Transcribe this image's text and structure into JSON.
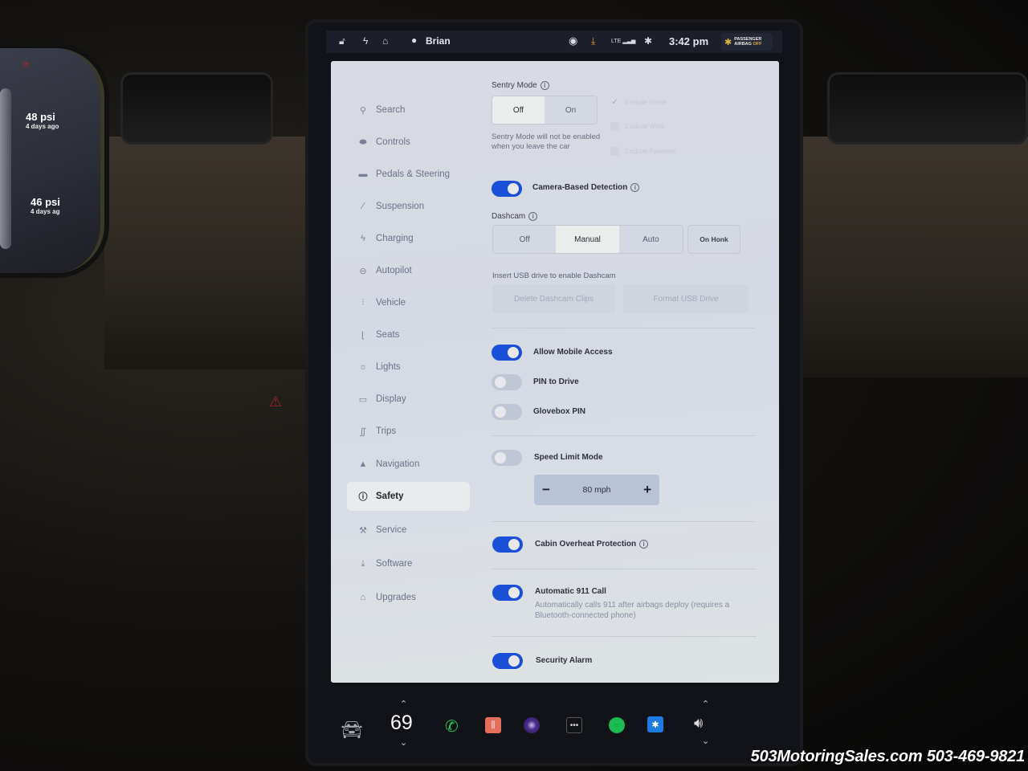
{
  "cluster": {
    "front_tire": {
      "pressure": "48",
      "unit": "psi",
      "age": "4 days ago"
    },
    "rear_tire": {
      "pressure": "46",
      "unit": "psi",
      "age": "4 days ag"
    }
  },
  "statusbar": {
    "icons": [
      "lock-open-icon",
      "bolt-icon",
      "home-link-icon"
    ],
    "user": "Brian",
    "right_icons": [
      "dashcam-record-icon",
      "download-update-icon",
      "lte-signal-icon",
      "bluetooth-icon"
    ],
    "lte_label": "LTE",
    "time": "3:42 pm",
    "airbag": {
      "line1": "PASSENGER",
      "line2_prefix": "AIRBAG",
      "line2_state": "OFF"
    }
  },
  "sidebar": {
    "items": [
      {
        "label": "Search",
        "icon": "search-icon",
        "glyph": "⚲"
      },
      {
        "label": "Controls",
        "icon": "toggle-icon",
        "glyph": "⬬"
      },
      {
        "label": "Pedals & Steering",
        "icon": "car-icon",
        "glyph": "▬"
      },
      {
        "label": "Suspension",
        "icon": "suspension-icon",
        "glyph": "⁄"
      },
      {
        "label": "Charging",
        "icon": "bolt-icon",
        "glyph": "ϟ"
      },
      {
        "label": "Autopilot",
        "icon": "steering-wheel-icon",
        "glyph": "⊖"
      },
      {
        "label": "Vehicle",
        "icon": "sliders-icon",
        "glyph": "⫶"
      },
      {
        "label": "Seats",
        "icon": "seat-icon",
        "glyph": "⌊"
      },
      {
        "label": "Lights",
        "icon": "sun-icon",
        "glyph": "☼"
      },
      {
        "label": "Display",
        "icon": "display-icon",
        "glyph": "▭"
      },
      {
        "label": "Trips",
        "icon": "trips-icon",
        "glyph": "∬"
      },
      {
        "label": "Navigation",
        "icon": "navigation-icon",
        "glyph": "▲"
      },
      {
        "label": "Safety",
        "icon": "safety-icon",
        "glyph": "ⓘ",
        "active": true
      },
      {
        "label": "Service",
        "icon": "wrench-icon",
        "glyph": "⚒"
      },
      {
        "label": "Software",
        "icon": "download-icon",
        "glyph": "⤓"
      },
      {
        "label": "Upgrades",
        "icon": "lock-icon",
        "glyph": "⌂"
      }
    ]
  },
  "safety": {
    "sentry": {
      "title": "Sentry Mode",
      "options": [
        "Off",
        "On"
      ],
      "selected": "Off",
      "note": "Sentry Mode will not be enabled when you leave the car",
      "exclude_home": "Exclude Home",
      "exclude_home_checked": true,
      "exclude_work": "Exclude Work",
      "exclude_work_checked": false,
      "exclude_favorites": "Exclude Favorites",
      "exclude_favorites_checked": false
    },
    "camera_detection": {
      "label": "Camera-Based Detection",
      "on": true
    },
    "dashcam": {
      "title": "Dashcam",
      "options": [
        "Off",
        "Manual",
        "Auto"
      ],
      "selected": "Manual",
      "on_honk": "On Honk",
      "usb_note": "Insert USB drive to enable Dashcam",
      "delete_clips": "Delete Dashcam Clips",
      "format_usb": "Format USB Drive"
    },
    "allow_mobile_access": {
      "label": "Allow Mobile Access",
      "on": true
    },
    "pin_to_drive": {
      "label": "PIN to Drive",
      "on": false
    },
    "glovebox_pin": {
      "label": "Glovebox PIN",
      "on": false
    },
    "speed_limit_mode": {
      "label": "Speed Limit Mode",
      "on": false,
      "value": "80 mph",
      "minus": "−",
      "plus": "+"
    },
    "cabin_overheat": {
      "label": "Cabin Overheat Protection",
      "on": true
    },
    "auto_911": {
      "label": "Automatic 911 Call",
      "on": true,
      "description": "Automatically calls 911 after airbags deploy (requires a Bluetooth-connected phone)"
    },
    "security_alarm": {
      "label": "Security Alarm",
      "on": true
    }
  },
  "dock": {
    "temperature": "69",
    "apps": [
      "phone-icon",
      "voice-memo-icon",
      "camera-icon",
      "more-apps-icon",
      "spotify-icon",
      "bluetooth-icon"
    ]
  },
  "watermark": "503MotoringSales.com 503-469-9821",
  "colors": {
    "toggle_on": "#1a4fd8",
    "toggle_off": "#bfc6d6",
    "panel_bg": "#d8dbe3",
    "statusbar_bg": "#1c1f2a"
  }
}
